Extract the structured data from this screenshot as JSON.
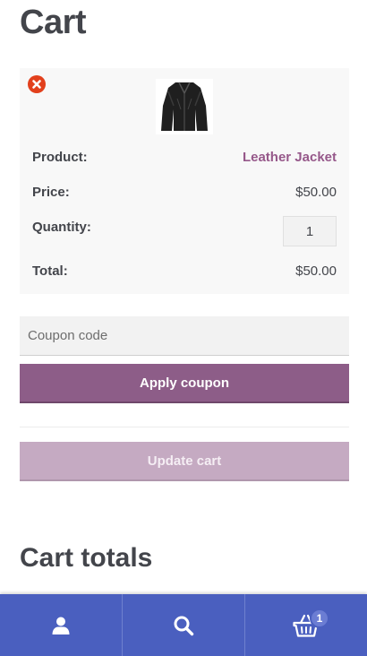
{
  "page": {
    "title": "Cart"
  },
  "cart_item": {
    "product_label": "Product:",
    "product_name": "Leather Jacket",
    "price_label": "Price:",
    "price": "$50.00",
    "quantity_label": "Quantity:",
    "quantity": "1",
    "total_label": "Total:",
    "total": "$50.00"
  },
  "coupon": {
    "placeholder": "Coupon code",
    "apply_label": "Apply coupon"
  },
  "update_label": "Update cart",
  "totals": {
    "title": "Cart totals"
  },
  "footer": {
    "icons": [
      "user-icon",
      "search-icon",
      "basket-icon"
    ],
    "cart_count": "1"
  },
  "colors": {
    "accent": "#96588a",
    "button": "#8d5d88",
    "button_disabled": "#c5aac2",
    "footer": "#4a5fbf",
    "remove": "#e2401c"
  }
}
